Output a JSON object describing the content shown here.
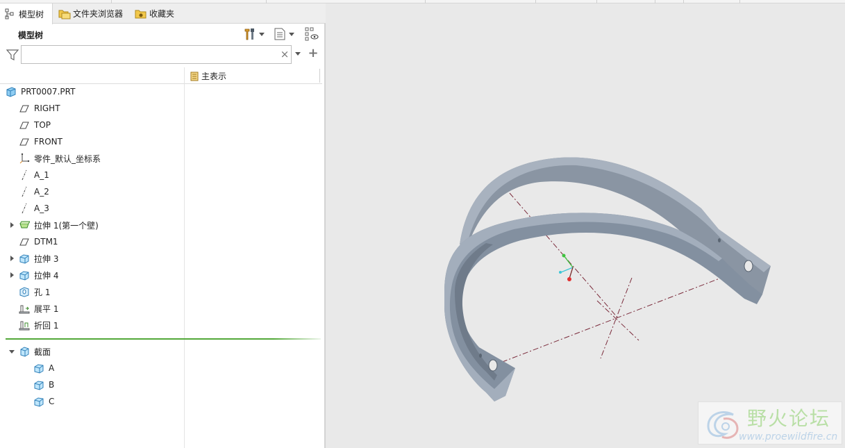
{
  "tabs": [
    {
      "label": "模型树",
      "icon": "model-tree-icon",
      "active": true
    },
    {
      "label": "文件夹浏览器",
      "icon": "folder-browser-icon",
      "active": false
    },
    {
      "label": "收藏夹",
      "icon": "favorites-icon",
      "active": false
    }
  ],
  "panel": {
    "title": "模型树",
    "settings_icon": "tree-settings-tools-icon",
    "show_icon": "tree-show-list-icon",
    "filter_icon": "tree-filter-visibility-icon"
  },
  "search": {
    "value": "",
    "placeholder": ""
  },
  "columns": {
    "display": "主表示"
  },
  "tree": {
    "root": "PRT0007.PRT",
    "items": [
      {
        "label": "RIGHT",
        "icon": "datum-plane-icon",
        "expandable": false
      },
      {
        "label": "TOP",
        "icon": "datum-plane-icon",
        "expandable": false
      },
      {
        "label": "FRONT",
        "icon": "datum-plane-icon",
        "expandable": false
      },
      {
        "label": "零件_默认_坐标系",
        "icon": "coordinate-system-icon",
        "expandable": false
      },
      {
        "label": "A_1",
        "icon": "datum-axis-icon",
        "expandable": false
      },
      {
        "label": "A_2",
        "icon": "datum-axis-icon",
        "expandable": false
      },
      {
        "label": "A_3",
        "icon": "datum-axis-icon",
        "expandable": false
      },
      {
        "label": "拉伸 1(第一个壁)",
        "icon": "sheetmetal-wall-icon",
        "expandable": true
      },
      {
        "label": "DTM1",
        "icon": "datum-plane-icon",
        "expandable": false
      },
      {
        "label": "拉伸 3",
        "icon": "extrude-icon",
        "expandable": true
      },
      {
        "label": "拉伸 4",
        "icon": "extrude-icon",
        "expandable": true
      },
      {
        "label": "孔 1",
        "icon": "hole-icon",
        "expandable": false
      },
      {
        "label": "展平 1",
        "icon": "unbend-icon",
        "expandable": false
      },
      {
        "label": "折回 1",
        "icon": "bend-back-icon",
        "expandable": false
      }
    ],
    "sections": {
      "label": "截面",
      "expanded": true,
      "children": [
        "A",
        "B",
        "C"
      ]
    }
  },
  "watermark": {
    "title": "野火论坛",
    "url": "www.proewildfire.cn"
  },
  "colors": {
    "background": "#e9e9e9",
    "part": "#8a95a3",
    "part_light": "#a7b1be",
    "insert_line": "#52a838",
    "icon_blue": "#4a9fd8"
  }
}
